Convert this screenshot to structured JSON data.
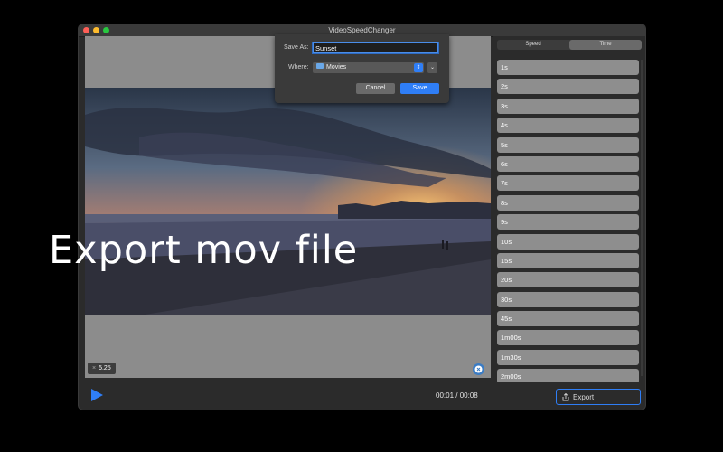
{
  "window": {
    "title": "VideoSpeedChanger"
  },
  "player": {
    "speed_badge_prefix": "×",
    "speed_badge_value": "5.25",
    "current_time": "00:01",
    "separator": "/",
    "duration": "00:08",
    "export_label": "Export"
  },
  "sidebar": {
    "tabs": [
      {
        "label": "Speed",
        "active": false
      },
      {
        "label": "Time",
        "active": true
      }
    ],
    "items": [
      "1s",
      "2s",
      "3s",
      "4s",
      "5s",
      "6s",
      "7s",
      "8s",
      "9s",
      "10s",
      "15s",
      "20s",
      "30s",
      "45s",
      "1m00s",
      "1m30s",
      "2m00s"
    ]
  },
  "save_sheet": {
    "save_as_label": "Save As:",
    "save_as_value": "Sunset",
    "where_label": "Where:",
    "where_value": "Movies",
    "cancel_label": "Cancel",
    "save_label": "Save"
  },
  "caption": "Export mov file",
  "colors": {
    "accent": "#2f7ef6",
    "list_item": "#8e8e8e",
    "window_bg": "#2b2b2b"
  }
}
